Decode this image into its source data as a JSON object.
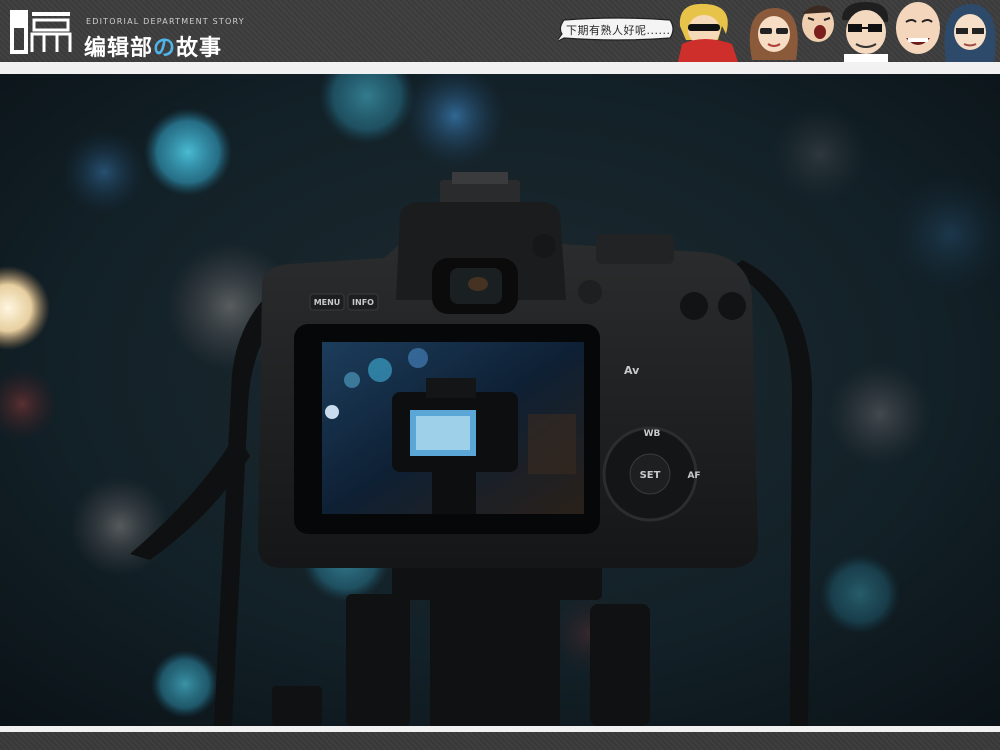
{
  "header": {
    "logo_glyph_alt": "编",
    "tagline": "EDITORIAL DEPARTMENT STORY",
    "title_part1": "编辑部",
    "title_no": "の",
    "title_part2": "故事",
    "bubble_text": "下期有熟人好呢......",
    "characters_icon": "cartoon-staff-caricatures"
  },
  "photo": {
    "subject_icon": "dslr-camera-on-tripod-bokeh",
    "camera_buttons": {
      "menu": "MENU",
      "info": "INFO",
      "av": "Av",
      "wb": "WB",
      "set": "SET",
      "af": "AF"
    }
  },
  "colors": {
    "header_bg": "#3d3d3d",
    "frame_white": "#f2f2f2",
    "accent_blue": "#4fb4e8",
    "bokeh_teal": "#3fa7c4",
    "bokeh_warm": "#f6e2b8"
  }
}
